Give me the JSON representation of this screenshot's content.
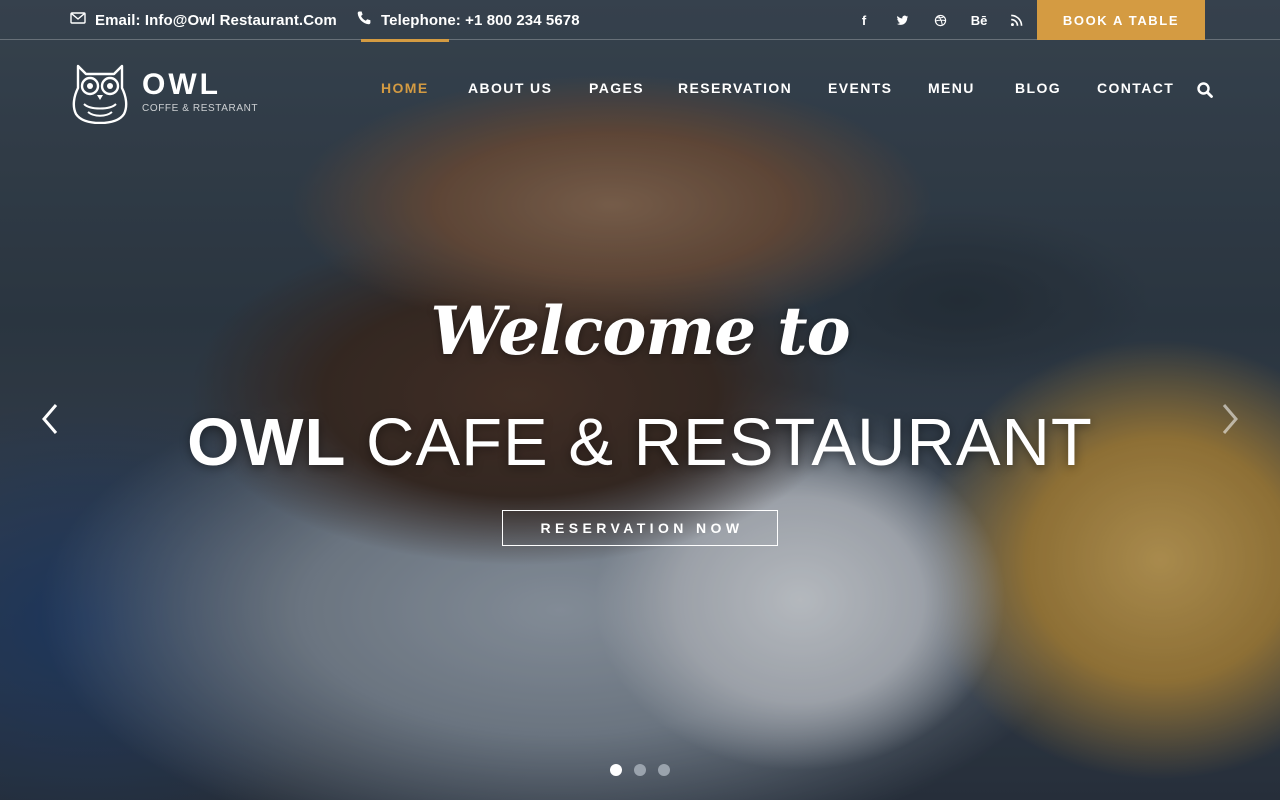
{
  "topbar": {
    "email": "Email: Info@Owl Restaurant.Com",
    "telephone": "Telephone: +1 800 234 5678",
    "social": [
      {
        "icon": "facebook-icon",
        "glyph": "f"
      },
      {
        "icon": "twitter-icon",
        "glyph": ""
      },
      {
        "icon": "dribbble-icon",
        "glyph": ""
      },
      {
        "icon": "behance-icon",
        "glyph": "Bē"
      },
      {
        "icon": "rss-icon",
        "glyph": ""
      }
    ],
    "book_label": "BOOK A TABLE"
  },
  "logo": {
    "name": "OWL",
    "tagline": "COFFE & RESTARANT"
  },
  "nav": {
    "items": [
      "HOME",
      "ABOUT US",
      "PAGES",
      "RESERVATION",
      "EVENTS",
      "MENU",
      "BLOG",
      "CONTACT"
    ],
    "active": "HOME"
  },
  "hero": {
    "welcome": "Welcome to",
    "headline_bold": "OWL",
    "headline_rest": " CAFE & RESTAURANT",
    "cta_label": "RESERVATION NOW",
    "active_slide": 1,
    "slide_count": 3
  },
  "colors": {
    "accent": "#d49b42",
    "text": "#ffffff",
    "dot_inactive": "#9aa3ad"
  }
}
